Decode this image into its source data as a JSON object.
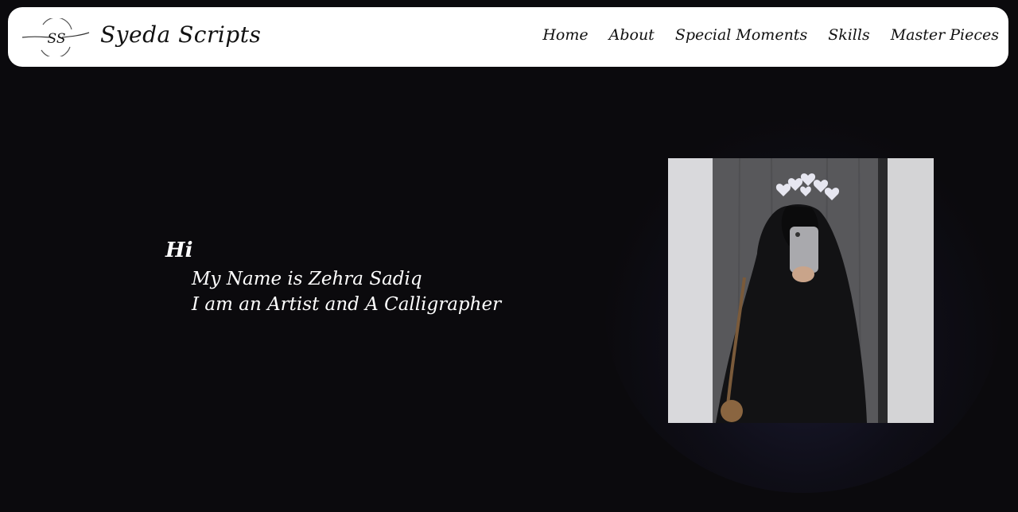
{
  "brand": {
    "logo_text": "SS",
    "name": "Syeda Scripts"
  },
  "nav": {
    "items": [
      {
        "label": "Home"
      },
      {
        "label": "About"
      },
      {
        "label": "Special Moments"
      },
      {
        "label": "Skills"
      },
      {
        "label": "Master Pieces"
      }
    ]
  },
  "hero": {
    "greeting": "Hi",
    "line1": "My Name is Zehra Sadiq",
    "line2": "I am an Artist and A Calligrapher"
  },
  "colors": {
    "page_background": "#0b0a0d",
    "navbar_background": "#ffffff",
    "nav_text": "#111111",
    "hero_text": "#ffffff"
  },
  "icons": {
    "logo": "ss-monogram-logo",
    "photo_decoration": "hearts-crown"
  }
}
